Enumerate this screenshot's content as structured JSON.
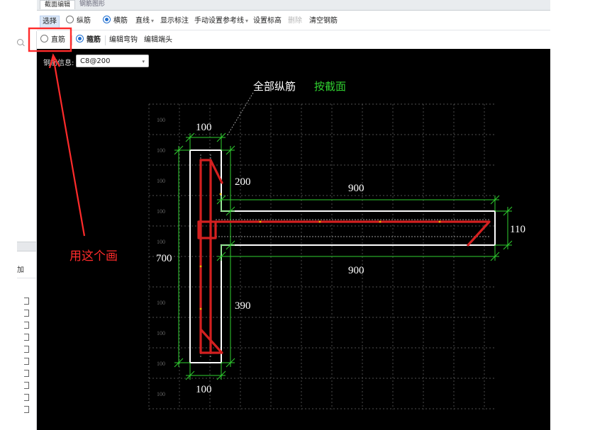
{
  "tabs": [
    "截面编辑",
    "钢筋图形"
  ],
  "toolbar1": {
    "select": "选择",
    "longitudinal": "纵筋",
    "transverse": "横筋",
    "line": "直线",
    "show_dims": "显示标注",
    "manual_ref": "手动设置参考线",
    "set_elev": "设置标高",
    "delete": "删除",
    "clear": "清空钢筋",
    "selected_radio": "transverse"
  },
  "toolbar2": {
    "straight": "直筋",
    "stirrup": "箍筋",
    "edit_hook": "编辑弯钩",
    "edit_end": "编辑端头",
    "selected_radio": "stirrup"
  },
  "left_panel": {
    "label": "加"
  },
  "rebar_info": {
    "label": "钢筋信息:",
    "value": "C8@200"
  },
  "drawing": {
    "title_white": "全部纵筋",
    "title_green": "按截面",
    "grid_labels": [
      "100",
      "100",
      "100",
      "100",
      "100",
      "100",
      "100",
      "100",
      "100"
    ],
    "dims": {
      "top_width": "100",
      "bottom_width": "100",
      "upper_height": "200",
      "lower_height": "390",
      "flange_top": "900",
      "flange_bottom": "900",
      "flange_thickness": "110",
      "total_height": "700"
    }
  },
  "annotation": {
    "text": "用这个画"
  },
  "colors": {
    "canvas": "#000000",
    "dimension": "#2fcf2f",
    "rebar": "#d42020",
    "annotation": "#ff2b2b",
    "outline": "#ffffff"
  }
}
